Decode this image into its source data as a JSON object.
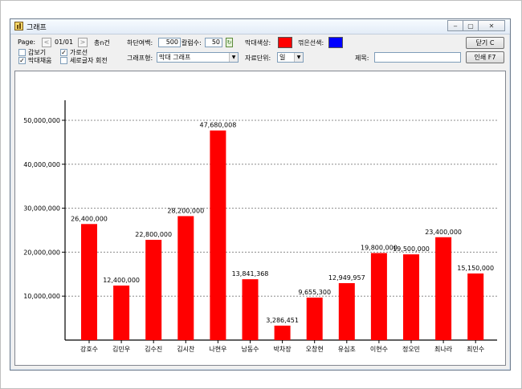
{
  "window": {
    "title": "그래프",
    "icon": "bar-chart-icon",
    "controls": [
      "minimize-icon",
      "restore-icon",
      "close-icon"
    ],
    "control_glyphs": {
      "minimize": "‒",
      "restore": "▢",
      "close": "✕"
    }
  },
  "toolbar": {
    "page_label": "Page:",
    "page_prev": "<",
    "page_value": "01/01",
    "page_next": ">",
    "total_label": "총n건",
    "bottom_margin_label": "하단여백:",
    "bottom_margin_value": "500",
    "column_width_label": "칼럼수:",
    "column_width_value": "50",
    "bar_color_label": "막대색상:",
    "bar_color": "#ff0000",
    "line_color_label": "꺾은선색:",
    "line_color": "#0000ff",
    "close_button": "닫기 C",
    "print_button": "인쇄 F7",
    "grid_toggle_label": "갑보기",
    "grid_toggle_checked": false,
    "horizontal_line_label": "가로선",
    "horizontal_line_checked": true,
    "fill_bar_label": "막대채움",
    "fill_bar_checked": true,
    "vertical_text_label": "세로글자 회전",
    "vertical_text_checked": false,
    "chart_type_label": "그래프형:",
    "chart_type_value": "막대 그래프",
    "unit_label": "자료단위:",
    "unit_value": "일",
    "title_label": "제목:",
    "title_value": "",
    "check_mark": "✓",
    "combo_arrow": "▼"
  },
  "chart_data": {
    "type": "bar",
    "categories": [
      "강호수",
      "김민우",
      "김수진",
      "김시찬",
      "나현우",
      "남동수",
      "박차장",
      "오창현",
      "유심초",
      "이현수",
      "정오민",
      "최나라",
      "최민수"
    ],
    "values": [
      26400000,
      12400000,
      22800000,
      28200000,
      47680008,
      13841368,
      3286451,
      9655300,
      12949957,
      19800000,
      19500000,
      23400000,
      15150000
    ],
    "value_labels": [
      "26,400,000",
      "12,400,000",
      "22,800,000",
      "28,200,000",
      "47,680,008",
      "13,841,368",
      "3,286,451",
      "9,655,300",
      "12,949,957",
      "19,800,000",
      "19,500,000",
      "23,400,000",
      "15,150,000"
    ],
    "y_ticks": [
      10000000,
      20000000,
      30000000,
      40000000,
      50000000
    ],
    "y_tick_labels": [
      "10,000,000",
      "20,000,000",
      "30,000,000",
      "40,000,000",
      "50,000,000"
    ],
    "ylim": [
      0,
      52000000
    ],
    "title": "",
    "xlabel": "",
    "ylabel": "",
    "grid": "horizontal dotted",
    "bar_color": "#ff0000"
  }
}
